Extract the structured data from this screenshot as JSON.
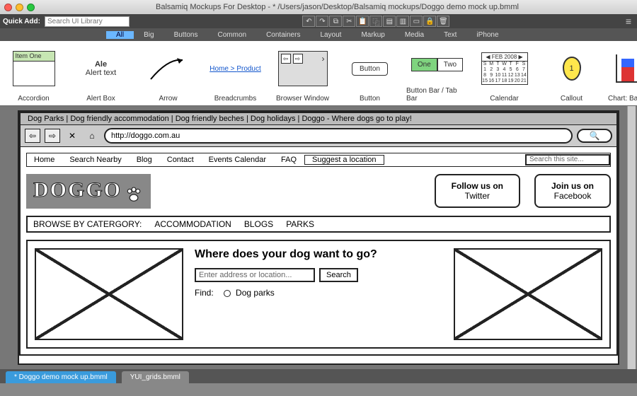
{
  "window": {
    "title": "Balsamiq Mockups For Desktop - * /Users/jason/Desktop/Balsamiq mockups/Doggo demo mock up.bmml"
  },
  "quickbar": {
    "label": "Quick Add:",
    "placeholder": "Search UI Library"
  },
  "categories": [
    "All",
    "Big",
    "Buttons",
    "Common",
    "Containers",
    "Layout",
    "Markup",
    "Media",
    "Text",
    "iPhone"
  ],
  "activeCategory": "All",
  "library": {
    "accordion": {
      "label": "Accordion",
      "item": "Item One"
    },
    "alert": {
      "label": "Alert Box",
      "title": "Ale",
      "text": "Alert text"
    },
    "arrow": {
      "label": "Arrow"
    },
    "breadcrumbs": {
      "label": "Breadcrumbs",
      "p1": "Home",
      "p2": "Product"
    },
    "browser": {
      "label": "Browser Window"
    },
    "button": {
      "label": "Button",
      "text": "Button"
    },
    "buttonbar": {
      "label": "Button Bar / Tab Bar",
      "one": "One",
      "two": "Two"
    },
    "calendar": {
      "label": "Calendar",
      "header": "◀ FEB 2008 ▶"
    },
    "callout": {
      "label": "Callout",
      "num": "1"
    },
    "chart": {
      "label": "Chart: Bar Chart"
    }
  },
  "mock": {
    "tabline": "Dog Parks | Dog friendly accommodation | Dog friendly beches | Dog holidays | Doggo - Where dogs go to play!",
    "url": "http://doggo.com.au",
    "nav": [
      "Home",
      "Search Nearby",
      "Blog",
      "Contact",
      "Events Calendar",
      "FAQ",
      "Suggest a location"
    ],
    "searchPlaceholder": "Search this site...",
    "logo": "DOGGO",
    "follow": {
      "line1": "Follow us on",
      "line2": "Twitter"
    },
    "join": {
      "line1": "Join us on",
      "line2": "Facebook"
    },
    "catrow": {
      "label": "BROWSE BY CATERGORY:",
      "c1": "ACCOMMODATION",
      "c2": "BLOGS",
      "c3": "PARKS"
    },
    "heading": "Where does your dog want to go?",
    "addrPlaceholder": "Enter address or location...",
    "searchBtn": "Search",
    "findLabel": "Find:",
    "findOpt1": "Dog parks"
  },
  "footerTabs": {
    "active": "* Doggo demo mock up.bmml",
    "inactive": "YUI_grids.bmml"
  }
}
